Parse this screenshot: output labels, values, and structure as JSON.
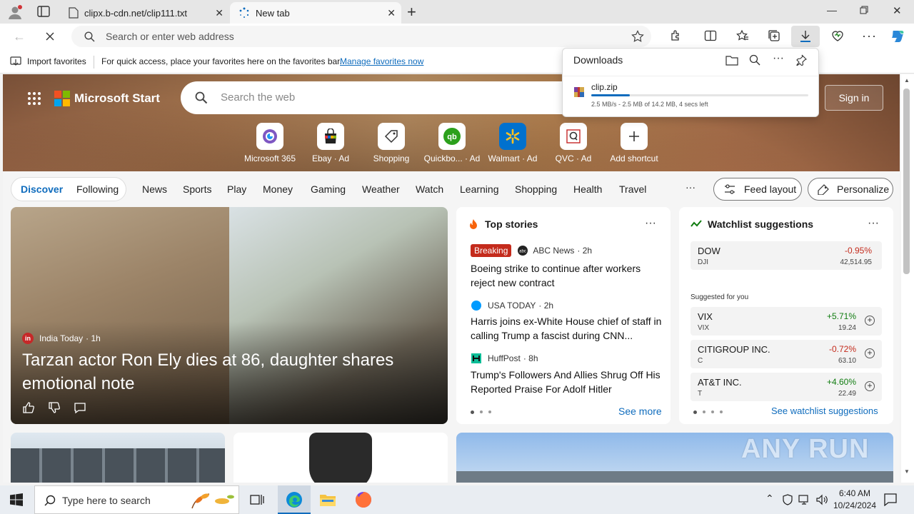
{
  "browser": {
    "tabs": [
      {
        "title": "clipx.b-cdn.net/clip111.txt",
        "active": false
      },
      {
        "title": "New tab",
        "active": true
      }
    ],
    "address_placeholder": "Search or enter web address"
  },
  "favorites_bar": {
    "import_label": "Import favorites",
    "hint": "For quick access, place your favorites here on the favorites bar.",
    "manage_link": "Manage favorites now"
  },
  "downloads": {
    "title": "Downloads",
    "file_name": "clip.zip",
    "status": "2.5 MB/s - 2.5 MB of 14.2 MB, 4 secs left",
    "progress": 0.176
  },
  "msn": {
    "brand": "Microsoft Start",
    "search_placeholder": "Search the web",
    "sign_in": "Sign in",
    "shortcuts": [
      {
        "label": "Microsoft 365",
        "icon": "m365-icon"
      },
      {
        "label": "Ebay · Ad",
        "icon": "ebay-icon"
      },
      {
        "label": "Shopping",
        "icon": "shopping-tag-icon"
      },
      {
        "label": "Quickbo... · Ad",
        "icon": "quickbooks-icon"
      },
      {
        "label": "Walmart · Ad",
        "icon": "walmart-icon"
      },
      {
        "label": "QVC · Ad",
        "icon": "qvc-icon"
      },
      {
        "label": "Add shortcut",
        "icon": "plus-icon"
      }
    ],
    "nav": {
      "discover": "Discover",
      "following": "Following",
      "items": [
        "News",
        "Sports",
        "Play",
        "Money",
        "Gaming",
        "Weather",
        "Watch",
        "Learning",
        "Shopping",
        "Health",
        "Travel"
      ],
      "more": "···",
      "feed_layout": "Feed layout",
      "personalize": "Personalize"
    },
    "hero_story": {
      "source": "India Today",
      "time": "· 1h",
      "headline": "Tarzan actor Ron Ely dies at 86, daughter shares emotional note"
    },
    "top_stories": {
      "title": "Top stories",
      "more": "···",
      "items": [
        {
          "badge": "Breaking",
          "source": "ABC News",
          "time": "· 2h",
          "headline": "Boeing strike to continue after workers reject new contract"
        },
        {
          "badge": "",
          "source": "USA TODAY",
          "time": "· 2h",
          "headline": "Harris joins ex-White House chief of staff in calling Trump a fascist during CNN..."
        },
        {
          "badge": "",
          "source": "HuffPost",
          "time": "· 8h",
          "headline": "Trump's Followers And Allies Shrug Off His Reported Praise For Adolf Hitler"
        }
      ],
      "see_more": "See more"
    },
    "watchlist": {
      "title": "Watchlist suggestions",
      "more": "···",
      "dow": {
        "name": "DOW",
        "symbol": "DJI",
        "change": "-0.95%",
        "price": "42,514.95"
      },
      "suggested_label": "Suggested for you",
      "suggestions": [
        {
          "name": "VIX",
          "symbol": "VIX",
          "change": "+5.71%",
          "price": "19.24",
          "up": true
        },
        {
          "name": "CITIGROUP INC.",
          "symbol": "C",
          "change": "-0.72%",
          "price": "63.10",
          "up": false
        },
        {
          "name": "AT&T INC.",
          "symbol": "T",
          "change": "+4.60%",
          "price": "22.49",
          "up": true
        }
      ],
      "see_all": "See watchlist suggestions"
    }
  },
  "taskbar": {
    "search_placeholder": "Type here to search",
    "time": "6:40 AM",
    "date": "10/24/2024"
  },
  "watermark": "ANY RUN",
  "colors": {
    "accent": "#0f6cbd",
    "down": "#c42b1c",
    "up": "#107c10",
    "breaking": "#c42b1c"
  }
}
